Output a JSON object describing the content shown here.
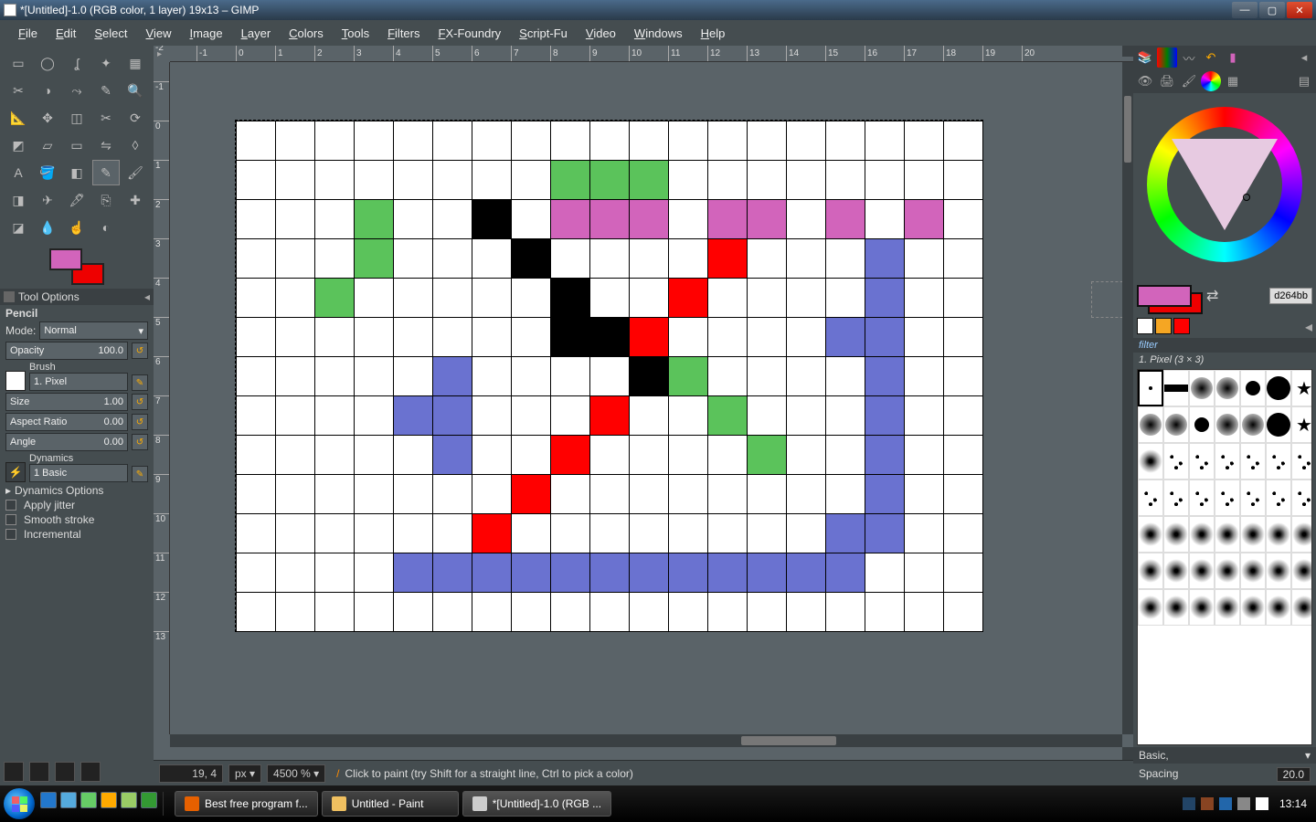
{
  "window": {
    "title": "*[Untitled]-1.0 (RGB color, 1 layer) 19x13 – GIMP",
    "min": "—",
    "max": "▢",
    "close": "✕"
  },
  "menu": [
    "File",
    "Edit",
    "Select",
    "View",
    "Image",
    "Layer",
    "Colors",
    "Tools",
    "Filters",
    "FX-Foundry",
    "Script-Fu",
    "Video",
    "Windows",
    "Help"
  ],
  "tooloptions": {
    "header": "Tool Options",
    "tool": "Pencil",
    "mode_label": "Mode:",
    "mode": "Normal",
    "opacity_label": "Opacity",
    "opacity": "100.0",
    "brush_label": "Brush",
    "brush": "1. Pixel",
    "size_label": "Size",
    "size": "1.00",
    "aspect_label": "Aspect Ratio",
    "aspect": "0.00",
    "angle_label": "Angle",
    "angle": "0.00",
    "dyn_label": "Dynamics",
    "dyn": "1 Basic",
    "dynopt": "Dynamics Options",
    "jitter": "Apply jitter",
    "smooth": "Smooth stroke",
    "incremental": "Incremental"
  },
  "ruler": {
    "h": [
      -1,
      0,
      1,
      2,
      3,
      4,
      5,
      6,
      7,
      8,
      9,
      10,
      11,
      12,
      13,
      14,
      15,
      16,
      17,
      18,
      19,
      20
    ],
    "v": [
      -2,
      -1,
      0,
      1,
      2,
      3,
      4,
      5,
      6,
      7,
      8,
      9,
      10,
      11,
      12,
      13
    ]
  },
  "pixels": {
    "cols": 19,
    "rows": 13,
    "cells": [
      [
        8,
        1,
        "#5bc35b"
      ],
      [
        9,
        1,
        "#5bc35b"
      ],
      [
        10,
        1,
        "#5bc35b"
      ],
      [
        3,
        2,
        "#5bc35b"
      ],
      [
        6,
        2,
        "#000"
      ],
      [
        8,
        2,
        "#d264bb"
      ],
      [
        9,
        2,
        "#d264bb"
      ],
      [
        10,
        2,
        "#d264bb"
      ],
      [
        12,
        2,
        "#d264bb"
      ],
      [
        13,
        2,
        "#d264bb"
      ],
      [
        15,
        2,
        "#d264bb"
      ],
      [
        17,
        2,
        "#d264bb"
      ],
      [
        3,
        3,
        "#5bc35b"
      ],
      [
        7,
        3,
        "#000"
      ],
      [
        12,
        3,
        "#f00"
      ],
      [
        16,
        3,
        "#6a72d0"
      ],
      [
        2,
        4,
        "#5bc35b"
      ],
      [
        8,
        4,
        "#000"
      ],
      [
        11,
        4,
        "#f00"
      ],
      [
        16,
        4,
        "#6a72d0"
      ],
      [
        8,
        5,
        "#000"
      ],
      [
        9,
        5,
        "#000"
      ],
      [
        10,
        5,
        "#f00"
      ],
      [
        15,
        5,
        "#6a72d0"
      ],
      [
        16,
        5,
        "#6a72d0"
      ],
      [
        5,
        6,
        "#6a72d0"
      ],
      [
        10,
        6,
        "#000"
      ],
      [
        11,
        6,
        "#5bc35b"
      ],
      [
        16,
        6,
        "#6a72d0"
      ],
      [
        4,
        7,
        "#6a72d0"
      ],
      [
        5,
        7,
        "#6a72d0"
      ],
      [
        9,
        7,
        "#f00"
      ],
      [
        12,
        7,
        "#5bc35b"
      ],
      [
        16,
        7,
        "#6a72d0"
      ],
      [
        5,
        8,
        "#6a72d0"
      ],
      [
        8,
        8,
        "#f00"
      ],
      [
        13,
        8,
        "#5bc35b"
      ],
      [
        16,
        8,
        "#6a72d0"
      ],
      [
        7,
        9,
        "#f00"
      ],
      [
        16,
        9,
        "#6a72d0"
      ],
      [
        6,
        10,
        "#f00"
      ],
      [
        15,
        10,
        "#6a72d0"
      ],
      [
        16,
        10,
        "#6a72d0"
      ],
      [
        4,
        11,
        "#6a72d0"
      ],
      [
        5,
        11,
        "#6a72d0"
      ],
      [
        6,
        11,
        "#6a72d0"
      ],
      [
        7,
        11,
        "#6a72d0"
      ],
      [
        8,
        11,
        "#6a72d0"
      ],
      [
        9,
        11,
        "#6a72d0"
      ],
      [
        10,
        11,
        "#6a72d0"
      ],
      [
        11,
        11,
        "#6a72d0"
      ],
      [
        12,
        11,
        "#6a72d0"
      ],
      [
        13,
        11,
        "#6a72d0"
      ],
      [
        14,
        11,
        "#6a72d0"
      ],
      [
        15,
        11,
        "#6a72d0"
      ]
    ]
  },
  "status": {
    "coord": "19, 4",
    "unit": "px",
    "zoom": "4500 %",
    "hint": "Click to paint (try Shift for a straight line, Ctrl to pick a color)"
  },
  "right": {
    "hex": "d264bb",
    "filter": "filter",
    "brushname": "1. Pixel (3 × 3)",
    "basic": "Basic,",
    "spacing_label": "Spacing",
    "spacing": "20.0"
  },
  "taskbar": {
    "tasks": [
      {
        "label": "Best free program f...",
        "color": "#e66000"
      },
      {
        "label": "Untitled - Paint",
        "color": "#f0c060"
      },
      {
        "label": "*[Untitled]-1.0 (RGB ...",
        "color": "#ccc"
      }
    ],
    "clock": "13:14"
  }
}
